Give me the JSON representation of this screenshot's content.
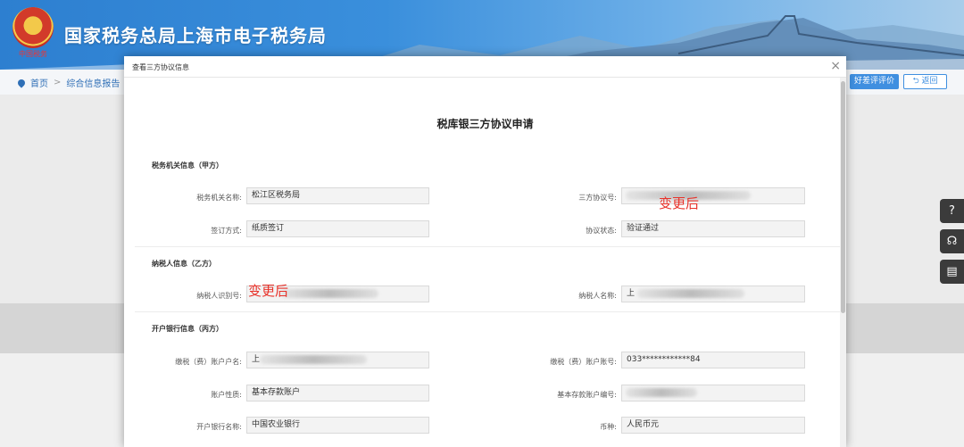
{
  "header": {
    "title": "国家税务总局上海市电子税务局",
    "emblem_text": "中国税务"
  },
  "breadcrumb": {
    "home": "首页",
    "separator": ">",
    "current": "综合信息报告"
  },
  "top_buttons": {
    "rate": "好差评评价",
    "back": "返回"
  },
  "side_tools": {
    "help": "?",
    "service": "☊",
    "manual": "▤"
  },
  "modal": {
    "title": "查看三方协议信息",
    "close": "×",
    "form_title": "税库银三方协议申请",
    "annotation": "变更后",
    "sections": {
      "tax_authority": {
        "title": "税务机关信息（甲方）",
        "authority_name": {
          "label": "税务机关名称:",
          "value": "松江区税务局"
        },
        "agreement_no": {
          "label": "三方协议号:",
          "value": ""
        },
        "sign_method": {
          "label": "签订方式:",
          "value": "纸质签订"
        },
        "agreement_status": {
          "label": "协议状态:",
          "value": "验证通过"
        }
      },
      "taxpayer": {
        "title": "纳税人信息（乙方）",
        "taxpayer_id": {
          "label": "纳税人识别号:",
          "value": ""
        },
        "taxpayer_name": {
          "label": "纳税人名称:",
          "value": "上"
        }
      },
      "bank": {
        "title": "开户银行信息（丙方）",
        "account_name": {
          "label": "缴税（费）账户户名:",
          "value": "上"
        },
        "account_no": {
          "label": "缴税（费）账户账号:",
          "value": "033************84"
        },
        "account_type": {
          "label": "账户性质:",
          "value": "基本存款账户"
        },
        "basic_account_code": {
          "label": "基本存款账户编号:",
          "value": ""
        },
        "bank_name": {
          "label": "开户银行名称:",
          "value": "中国农业银行"
        },
        "currency": {
          "label": "币种:",
          "value": "人民币元"
        }
      }
    }
  },
  "colors": {
    "accent": "#3f8fe0",
    "annotation": "#e8322a"
  }
}
